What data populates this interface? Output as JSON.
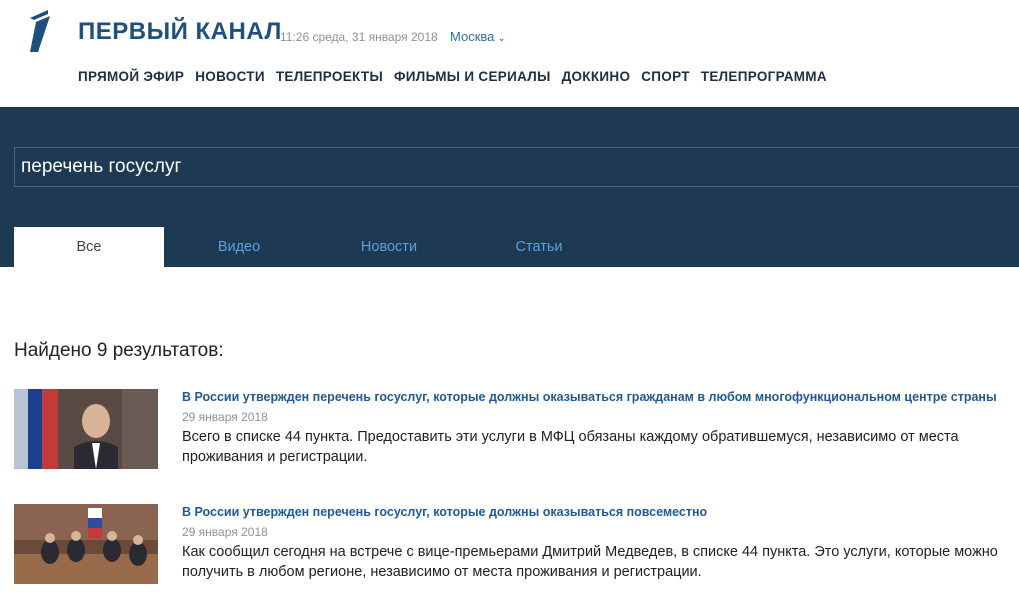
{
  "header": {
    "brand": "ПЕРВЫЙ КАНАЛ",
    "datetime": "11:26 среда, 31 января 2018",
    "city": "Москва",
    "logo_icon": "channel-one-logo",
    "nav": [
      "ПРЯМОЙ ЭФИР",
      "НОВОСТИ",
      "ТЕЛЕПРОЕКТЫ",
      "ФИЛЬМЫ И СЕРИАЛЫ",
      "ДОККИНО",
      "СПОРТ",
      "ТЕЛЕПРОГРАММА"
    ]
  },
  "search": {
    "query": "перечень госуслуг",
    "tabs": [
      {
        "label": "Все",
        "active": true
      },
      {
        "label": "Видео",
        "active": false
      },
      {
        "label": "Новости",
        "active": false
      },
      {
        "label": "Статьи",
        "active": false
      }
    ]
  },
  "results": {
    "count_text": "Найдено 9 результатов:",
    "items": [
      {
        "title": "В России утвержден перечень госуслуг, которые должны оказываться гражданам в любом многофункциональном центре страны",
        "date": "29 января 2018",
        "text": "Всего в списке 44 пункта. Предоставить эти услуги в МФЦ обязаны каждому обратившемуся, независимо от места проживания и регистрации."
      },
      {
        "title": "В России утвержден перечень госуслуг, которые должны оказываться повсеместно",
        "date": "29 января 2018",
        "text": "Как сообщил сегодня на встрече с вице-премьерами Дмитрий Медведев, в списке 44 пункта. Это услуги, которые можно получить в любом регионе, независимо от места проживания и регистрации."
      }
    ]
  },
  "colors": {
    "brand": "#1d4f7f",
    "search_band": "#1e3a52",
    "link": "#1f5a98",
    "tab_inactive": "#5aa0e0"
  }
}
